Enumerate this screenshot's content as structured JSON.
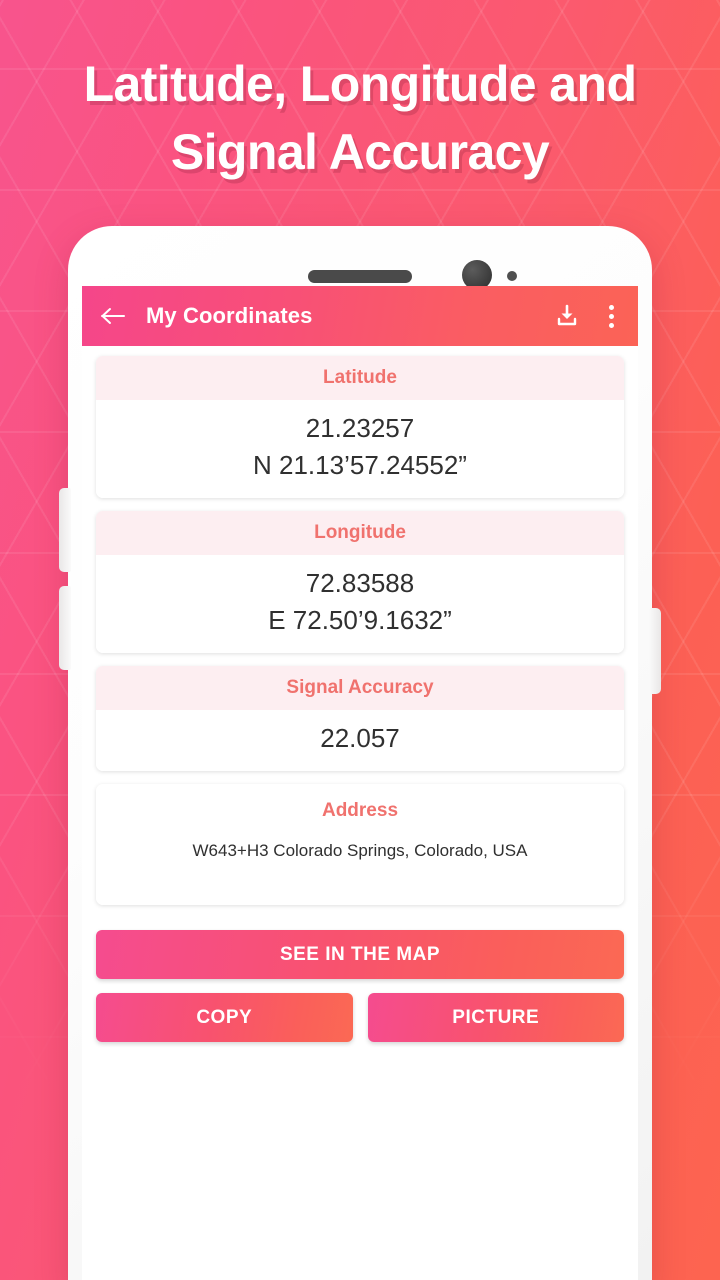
{
  "promo": {
    "headline_lines": [
      "Latitude, Longitude and",
      "Signal Accuracy"
    ],
    "background_start_color": "#F8548D",
    "background_end_color": "#FD6450"
  },
  "app_bar": {
    "back_icon": "arrow-left-icon",
    "title": "My Coordinates",
    "download_icon": "download-icon",
    "overflow_icon": "more-vertical-icon",
    "gradient_start": "#F5468A",
    "gradient_end": "#FB6356"
  },
  "cards": [
    {
      "label": "Latitude",
      "value_primary": "21.23257",
      "value_secondary": "N 21.13’57.24552”"
    },
    {
      "label": "Longitude",
      "value_primary": "72.83588",
      "value_secondary": "E 72.50’9.1632”"
    },
    {
      "label": "Signal Accuracy",
      "value_primary": "22.057",
      "value_secondary": ""
    },
    {
      "label": "Address",
      "value_primary": "W643+H3 Colorado Springs, Colorado, USA",
      "value_secondary": ""
    }
  ],
  "label_color": "#F0726E",
  "label_background": "#FDEEF1",
  "buttons": {
    "see_in_map": "SEE IN THE MAP",
    "copy": "COPY",
    "picture": "PICTURE"
  },
  "device": {
    "speaker": "speaker-grille",
    "front_camera": "front-camera-icon",
    "proximity_sensor": "proximity-sensor-icon",
    "volume_up": "volume-up-button",
    "volume_down": "volume-down-button",
    "power": "power-button"
  }
}
